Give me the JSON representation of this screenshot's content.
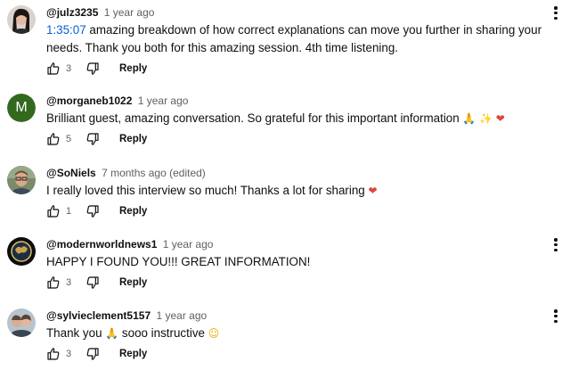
{
  "comments": [
    {
      "author": "@julz3235",
      "date": "1 year ago",
      "timestamp": "1:35:07",
      "text": " amazing breakdown of how correct explanations can move you further in sharing your needs. Thank you both for this amazing session. 4th time listening.",
      "likes": "3",
      "reply_label": "Reply",
      "avatar": "photo"
    },
    {
      "author": "@morganeb1022",
      "date": "1 year ago",
      "avatar_letter": "M",
      "avatar_color": "#33691e",
      "text": "Brilliant guest, amazing conversation. So grateful for this important information ",
      "emojis": [
        "folded-hands-emoji",
        "sparkles-emoji",
        "red-heart-emoji"
      ],
      "likes": "5",
      "reply_label": "Reply"
    },
    {
      "author": "@SoNiels",
      "date": "7 months ago (edited)",
      "text": "I really loved this interview so much! Thanks a lot for sharing ",
      "emojis": [
        "red-heart-emoji"
      ],
      "likes": "1",
      "reply_label": "Reply",
      "avatar": "photo"
    },
    {
      "author": "@modernworldnews1",
      "date": "1 year ago",
      "text": "HAPPY I FOUND YOU!!! GREAT INFORMATION!",
      "likes": "3",
      "reply_label": "Reply",
      "avatar": "photo"
    },
    {
      "author": "@sylvieclement5157",
      "date": "1 year ago",
      "text_before": "Thank you ",
      "text_middle": " sooo instructive ",
      "emojis": [
        "folded-hands-emoji",
        "smiling-face-emoji"
      ],
      "likes": "3",
      "reply_label": "Reply",
      "avatar": "photo"
    }
  ],
  "colors": {
    "timestamp_link": "#065fd4",
    "meta_text": "#606060",
    "heart": "#e0453a"
  },
  "icons": [
    "thumbs-up-icon",
    "thumbs-down-icon",
    "more-vert-icon"
  ]
}
